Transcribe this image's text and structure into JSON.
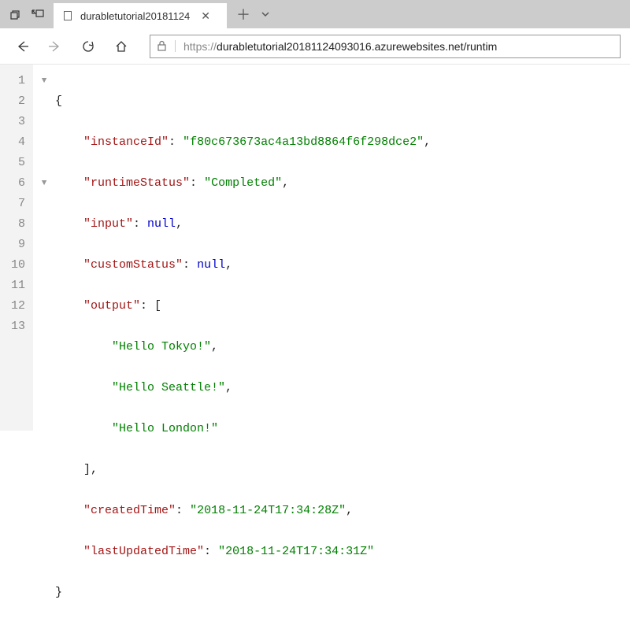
{
  "window": {
    "tab_title": "durabletutorial20181124"
  },
  "nav": {
    "url_proto": "https://",
    "url_rest": "durabletutorial20181124093016.azurewebsites.net/runtim"
  },
  "json_view": {
    "lines": [
      "1",
      "2",
      "3",
      "4",
      "5",
      "6",
      "7",
      "8",
      "9",
      "10",
      "11",
      "12",
      "13"
    ],
    "content": {
      "instanceId_key": "\"instanceId\"",
      "instanceId_val": "\"f80c673673ac4a13bd8864f6f298dce2\"",
      "runtimeStatus_key": "\"runtimeStatus\"",
      "runtimeStatus_val": "\"Completed\"",
      "input_key": "\"input\"",
      "input_val": "null",
      "customStatus_key": "\"customStatus\"",
      "customStatus_val": "null",
      "output_key": "\"output\"",
      "output_v1": "\"Hello Tokyo!\"",
      "output_v2": "\"Hello Seattle!\"",
      "output_v3": "\"Hello London!\"",
      "createdTime_key": "\"createdTime\"",
      "createdTime_val": "\"2018-11-24T17:34:28Z\"",
      "lastUpdatedTime_key": "\"lastUpdatedTime\"",
      "lastUpdatedTime_val": "\"2018-11-24T17:34:31Z\""
    }
  }
}
